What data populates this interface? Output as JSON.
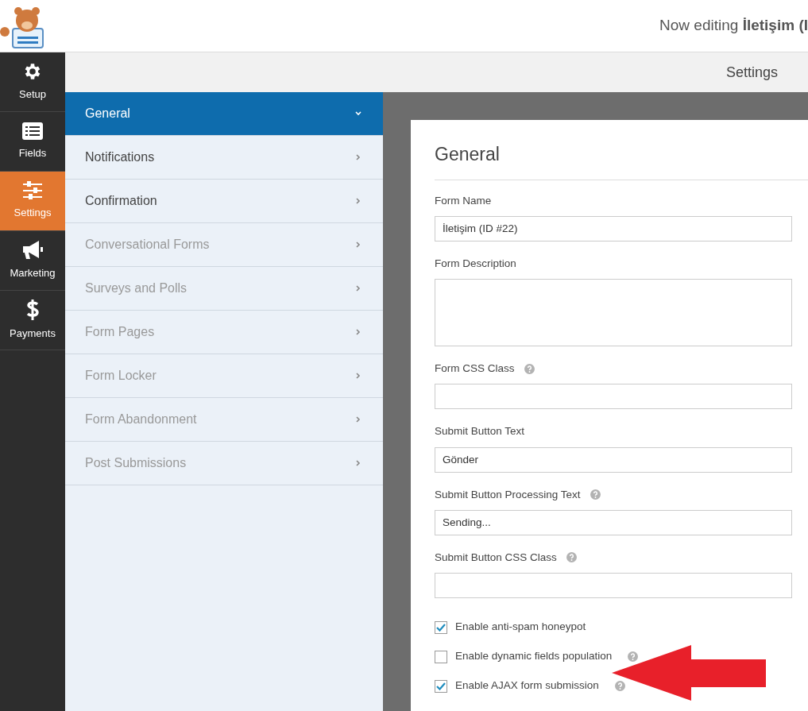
{
  "header": {
    "title": "Now editing **İletişim (I**"
  },
  "sidebar": {
    "items": [
      {
        "label": "Setup",
        "selected": false
      },
      {
        "label": "Fields",
        "selected": false
      },
      {
        "label": "Settings",
        "selected": true
      },
      {
        "label": "Marketing",
        "selected": false
      },
      {
        "label": "Payments",
        "selected": false
      }
    ]
  },
  "toolbar": {
    "title": "Settings"
  },
  "panel_menu": [
    {
      "label": "General",
      "selected": true,
      "disabled": false
    },
    {
      "label": "Notifications",
      "selected": false,
      "disabled": false
    },
    {
      "label": "Confirmation",
      "selected": false,
      "disabled": false
    },
    {
      "label": "Conversational Forms",
      "selected": false,
      "disabled": true
    },
    {
      "label": "Surveys and Polls",
      "selected": false,
      "disabled": true
    },
    {
      "label": "Form Pages",
      "selected": false,
      "disabled": true
    },
    {
      "label": "Form Locker",
      "selected": false,
      "disabled": true
    },
    {
      "label": "Form Abandonment",
      "selected": false,
      "disabled": true
    },
    {
      "label": "Post Submissions",
      "selected": false,
      "disabled": true
    }
  ],
  "section": {
    "title": "General",
    "fields": [
      {
        "kind": "text",
        "label": "Form Name",
        "help": false,
        "value": "İletişim (ID #22)"
      },
      {
        "kind": "textarea",
        "label": "Form Description",
        "help": false
      },
      {
        "kind": "text",
        "label": "Form CSS Class",
        "help": true
      },
      {
        "kind": "text",
        "label": "Submit Button Text",
        "help": false,
        "value": "Gönder"
      },
      {
        "kind": "text",
        "label": "Submit Button Processing Text",
        "help": true,
        "value": "Sending..."
      },
      {
        "kind": "text",
        "label": "Submit Button CSS Class",
        "help": true
      },
      {
        "kind": "checkbox",
        "label": "Enable anti-spam honeypot",
        "help": false,
        "checked": true
      },
      {
        "kind": "checkbox",
        "label": "Enable dynamic fields population",
        "help": true,
        "checked": false
      },
      {
        "kind": "checkbox",
        "label": "Enable AJAX form submission",
        "help": true,
        "checked": true
      }
    ]
  }
}
